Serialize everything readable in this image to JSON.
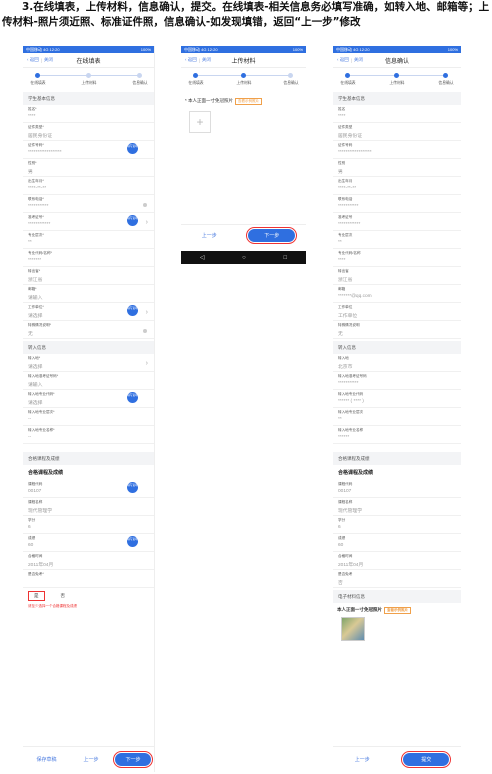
{
  "instruction": "3.在线填表，上传材料，信息确认，提交。在线填表-相关信息务必填写准确，如转入地、邮箱等；上传材料-照片须近照、标准证件照，信息确认-如发现填错，返回“上一步”修改",
  "status_bar": {
    "left": "中国移动 4G 12:20",
    "right": "100%"
  },
  "phone1": {
    "nav": {
      "back": "返回",
      "close": "关闭",
      "title": "在线填表"
    },
    "steps": [
      "在线填表",
      "上传材料",
      "信息确认"
    ],
    "sections": {
      "student": "学生基本信息",
      "transfer": "转入信息",
      "course": "合格课程及成绩"
    },
    "fields": [
      {
        "label": "姓名*",
        "value": "****"
      },
      {
        "label": "证件类型*",
        "value": "居民身份证"
      },
      {
        "label": "证件号码*",
        "value": "******************"
      },
      {
        "label": "性别*",
        "value": "男"
      },
      {
        "label": "出生年月*",
        "value": "****-**-**"
      },
      {
        "label": "联系电话*",
        "value": "***********"
      },
      {
        "label": "准考证号*",
        "value": "************"
      },
      {
        "label": "专业层次*",
        "value": "**"
      },
      {
        "label": "专业代码/名称*",
        "value": "*******"
      },
      {
        "label": "转出省*",
        "value": "浙江省"
      },
      {
        "label": "邮箱*",
        "value": "请输入"
      },
      {
        "label": "工作单位*",
        "value": "请选择"
      },
      {
        "label": "特殊情况说明*",
        "value": "无"
      }
    ],
    "transfer_fields": [
      {
        "label": "转入地*",
        "value": "请选择"
      },
      {
        "label": "转入地准考证号码*",
        "value": "请输入"
      },
      {
        "label": "转入地专业代码*",
        "value": "请选择"
      },
      {
        "label": "转入地专业层次*",
        "value": "--"
      },
      {
        "label": "转入地专业名称*",
        "value": "--"
      }
    ],
    "course_title": "合格课程及成绩",
    "course_fields": [
      {
        "label": "课程代码",
        "value": "00107"
      },
      {
        "label": "课程名称",
        "value": "现代管理学"
      },
      {
        "label": "学分",
        "value": "6"
      },
      {
        "label": "成绩",
        "value": "60"
      },
      {
        "label": "合格时间",
        "value": "2011年04月"
      },
      {
        "label": "是否免考*",
        "value": ""
      }
    ],
    "radio": {
      "yes": "是",
      "no": "否"
    },
    "error": "请至少选择一个合格课程及成绩",
    "fab": "填写说明",
    "buttons": {
      "save": "保存草稿",
      "prev": "上一步",
      "next": "下一步"
    }
  },
  "phone2": {
    "nav": {
      "back": "返回",
      "close": "关闭",
      "title": "上传材料"
    },
    "steps": [
      "在线填表",
      "上传材料",
      "信息确认"
    ],
    "photo_label": "本人正面一寸免冠照片",
    "tag": "查看示例照片",
    "buttons": {
      "prev": "上一步",
      "next": "下一步"
    },
    "android_nav": [
      "◁",
      "○",
      "□"
    ]
  },
  "phone3": {
    "nav": {
      "back": "返回",
      "close": "关闭",
      "title": "信息确认"
    },
    "steps": [
      "在线填表",
      "上传材料",
      "信息确认"
    ],
    "sections": {
      "student": "学生基本信息",
      "transfer": "转入信息",
      "course": "合格课程及成绩",
      "material": "电子材料信息"
    },
    "fields": [
      {
        "label": "姓名",
        "value": "****"
      },
      {
        "label": "证件类型",
        "value": "居民身份证"
      },
      {
        "label": "证件号码",
        "value": "******************"
      },
      {
        "label": "性别",
        "value": "男"
      },
      {
        "label": "出生年月",
        "value": "****-**-**"
      },
      {
        "label": "联系电话",
        "value": "***********"
      },
      {
        "label": "准考证号",
        "value": "************"
      },
      {
        "label": "专业层次",
        "value": "**"
      },
      {
        "label": "专业代码/名称",
        "value": "****"
      },
      {
        "label": "转出省",
        "value": "浙江省"
      },
      {
        "label": "邮箱",
        "value": "*******@qq.com"
      },
      {
        "label": "工作单位",
        "value": "工作单位"
      },
      {
        "label": "特殊情况说明",
        "value": "无"
      }
    ],
    "transfer_fields": [
      {
        "label": "转入地",
        "value": "北京市"
      },
      {
        "label": "转入地准考证号码",
        "value": "***********"
      },
      {
        "label": "转入地专业代码",
        "value": "****** ( **** )"
      },
      {
        "label": "转入地专业层次",
        "value": "**"
      },
      {
        "label": "转入地专业名称",
        "value": "******"
      }
    ],
    "course_title": "合格课程及成绩",
    "course_fields": [
      {
        "label": "课程代码",
        "value": "00107"
      },
      {
        "label": "课程名称",
        "value": "现代管理学"
      },
      {
        "label": "学分",
        "value": "6"
      },
      {
        "label": "成绩",
        "value": "60"
      },
      {
        "label": "合格时间",
        "value": "2011年04月"
      },
      {
        "label": "是否免考",
        "value": "否"
      }
    ],
    "photo_label": "本人正面一寸免冠照片",
    "tag": "查看示例照片",
    "buttons": {
      "prev": "上一步",
      "submit": "提交"
    }
  }
}
